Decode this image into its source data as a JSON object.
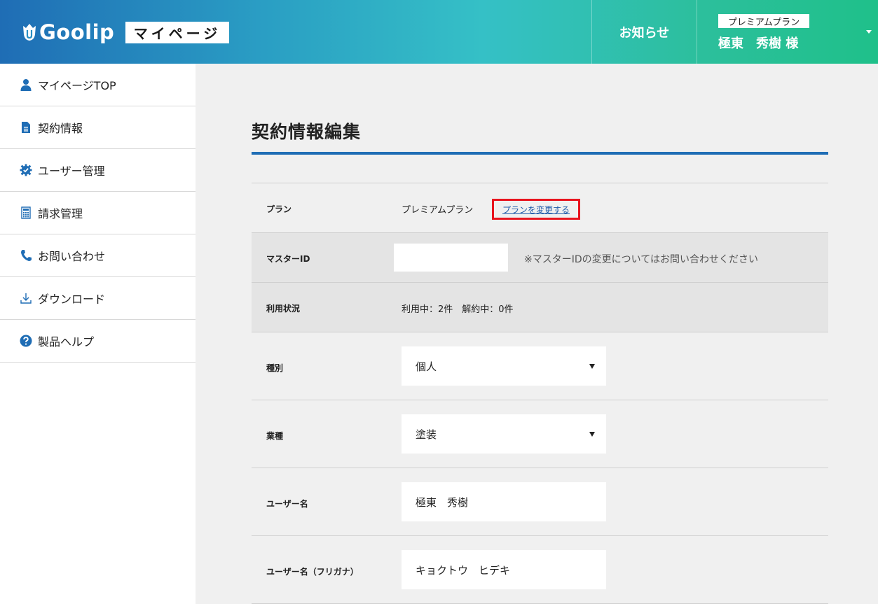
{
  "header": {
    "logo_text": "Goolip",
    "section_label": "マイページ",
    "news_label": "お知らせ",
    "plan_badge": "プレミアムプラン",
    "user_name": "極東　秀樹 様"
  },
  "sidebar": {
    "items": [
      {
        "label": "マイページTOP",
        "icon": "user-icon"
      },
      {
        "label": "契約情報",
        "icon": "document-icon"
      },
      {
        "label": "ユーザー管理",
        "icon": "gear-check-icon"
      },
      {
        "label": "請求管理",
        "icon": "calculator-icon"
      },
      {
        "label": "お問い合わせ",
        "icon": "phone-icon"
      },
      {
        "label": "ダウンロード",
        "icon": "download-icon"
      },
      {
        "label": "製品ヘルプ",
        "icon": "help-icon"
      }
    ]
  },
  "main": {
    "title": "契約情報編集",
    "rows": {
      "plan": {
        "label": "プラン",
        "value": "プレミアムプラン",
        "link": "プランを変更する"
      },
      "master_id": {
        "label": "マスターID",
        "value": "",
        "note": "※マスターIDの変更についてはお問い合わせください"
      },
      "usage": {
        "label": "利用状況",
        "value": "利用中：2件　解約中：0件"
      },
      "type": {
        "label": "種別",
        "value": "個人"
      },
      "industry": {
        "label": "業種",
        "value": "塗装"
      },
      "username": {
        "label": "ユーザー名",
        "value": "極東　秀樹"
      },
      "username_kana": {
        "label": "ユーザー名（フリガナ）",
        "value": "キョクトウ　ヒデキ"
      }
    }
  },
  "colors": {
    "accent_blue": "#1f6db5",
    "highlight_red": "#e8141e",
    "link_blue": "#1f5aa8"
  }
}
